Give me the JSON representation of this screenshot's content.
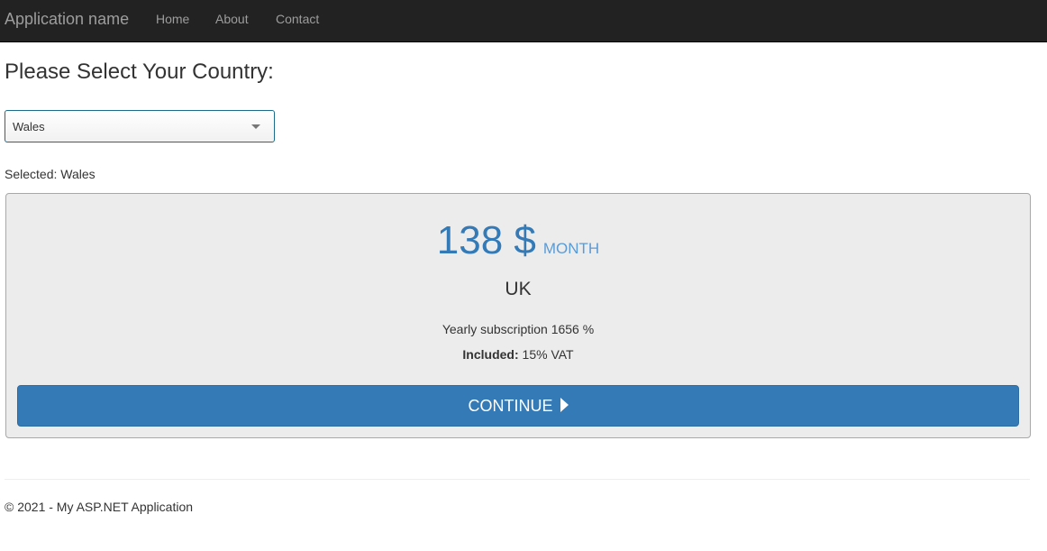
{
  "navbar": {
    "brand": "Application name",
    "links": [
      {
        "label": "Home"
      },
      {
        "label": "About"
      },
      {
        "label": "Contact"
      }
    ]
  },
  "page": {
    "title": "Please Select Your Country:"
  },
  "country_select": {
    "value": "Wales",
    "icon": "chevron-down-icon"
  },
  "selection": {
    "label": "Selected:",
    "value": "Wales"
  },
  "pricing": {
    "amount": "138 $",
    "period": "MONTH",
    "region": "UK",
    "yearly_label": "Yearly subscription",
    "yearly_value": "1656 %",
    "included_label": "Included:",
    "included_value": "15% VAT",
    "button_label": "CONTINUE",
    "button_icon": "play-icon"
  },
  "footer": {
    "text": "© 2021 - My ASP.NET Application"
  },
  "colors": {
    "navbar_bg": "#222222",
    "nav_text": "#9d9d9d",
    "accent": "#337ab7",
    "period_text": "#5b9bd5",
    "panel_bg": "#ececec"
  }
}
